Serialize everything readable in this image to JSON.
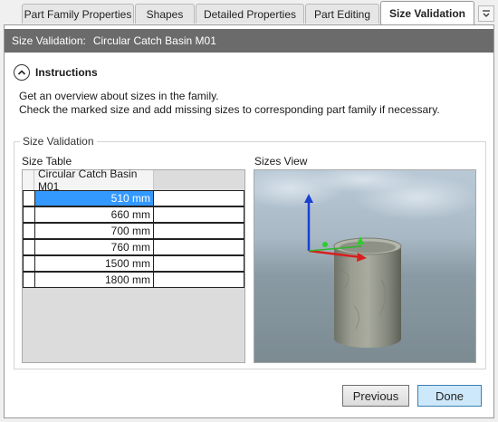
{
  "tabs": [
    {
      "label": "Part Family Properties"
    },
    {
      "label": "Shapes"
    },
    {
      "label": "Detailed Properties"
    },
    {
      "label": "Part Editing"
    },
    {
      "label": "Size Validation"
    }
  ],
  "tab_scroll_icon": "chevron-down-icon",
  "header": {
    "label": "Size Validation:",
    "value": "Circular Catch Basin M01"
  },
  "instructions": {
    "title": "Instructions",
    "toggle_icon": "chevron-up-icon",
    "line1": "Get an overview about sizes in the family.",
    "line2": "Check the marked size and add missing sizes to corresponding part family if necessary."
  },
  "group": {
    "title": "Size Validation",
    "size_table_label": "Size Table",
    "sizes_view_label": "Sizes View"
  },
  "table": {
    "column": "Circular Catch Basin M01",
    "rows": [
      "510 mm",
      "660 mm",
      "700 mm",
      "760 mm",
      "1500 mm",
      "1800 mm"
    ],
    "selected_index": 0
  },
  "buttons": {
    "previous": "Previous",
    "done": "Done"
  },
  "colors": {
    "header_bg": "#6b6b6b",
    "selection": "#3399ff",
    "done_bg": "#cde8fb"
  }
}
